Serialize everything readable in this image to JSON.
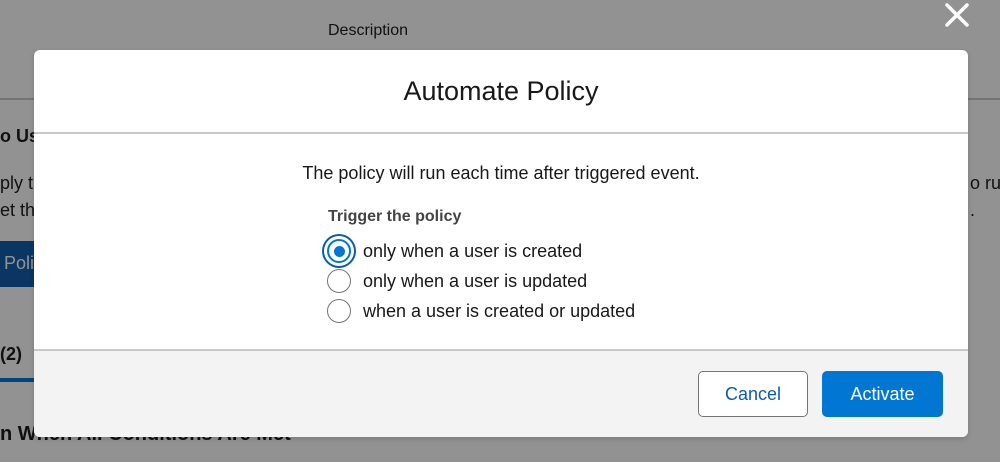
{
  "background": {
    "description_header": "Description",
    "heading_fragment": "o Us",
    "line1_left": "ply t",
    "line2_left": "et th",
    "line1_right": "o ru",
    "line2_right": ".",
    "button_fragment": "Poli",
    "tab_fragment": "(2)",
    "section_fragment": "n When All Conditions Are Met"
  },
  "modal": {
    "title": "Automate Policy",
    "message": "The policy will run each time after triggered event.",
    "trigger": {
      "legend": "Trigger the policy",
      "options": [
        {
          "label": "only when a user is created",
          "checked": true
        },
        {
          "label": "only when a user is updated",
          "checked": false
        },
        {
          "label": "when a user is created or updated",
          "checked": false
        }
      ]
    },
    "footer": {
      "cancel_label": "Cancel",
      "activate_label": "Activate"
    }
  },
  "colors": {
    "brand": "#0176d3",
    "brand_dark": "#0b5cab",
    "overlay": "rgba(8,7,7,0.44)",
    "footer_bg": "#f3f3f3"
  },
  "icons": {
    "close": "close-icon"
  }
}
